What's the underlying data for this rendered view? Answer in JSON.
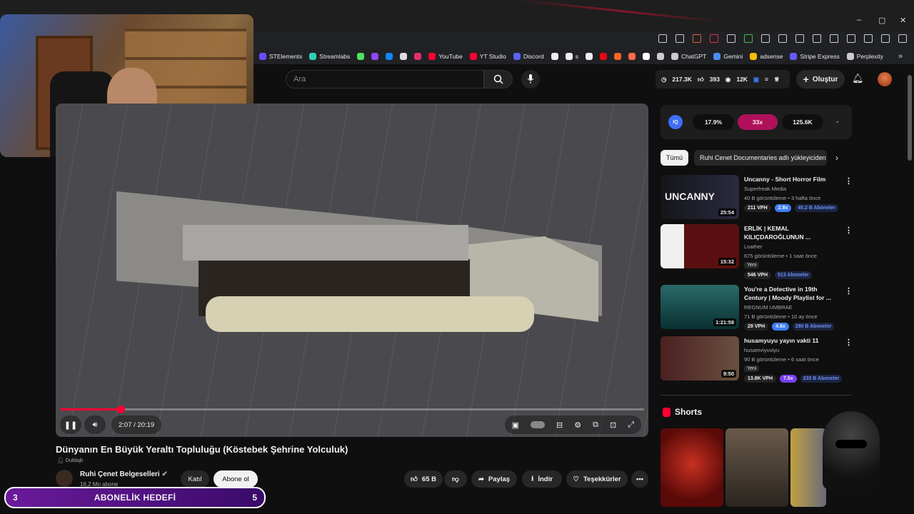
{
  "window": {
    "minimize": "–",
    "maximize": "▢",
    "close": "✕"
  },
  "bookmarks": [
    {
      "label": "STElements",
      "color": "#6a4cff"
    },
    {
      "label": "Streamlabs",
      "color": "#2fd0b0"
    },
    {
      "label": "",
      "color": "#52e060"
    },
    {
      "label": "",
      "color": "#9146ff"
    },
    {
      "label": "",
      "color": "#1185fe"
    },
    {
      "label": "",
      "color": "#dddddd"
    },
    {
      "label": "",
      "color": "#e1306c"
    },
    {
      "label": "YouTube",
      "color": "#ff0033"
    },
    {
      "label": "YT Studio",
      "color": "#ff0033"
    },
    {
      "label": "Discord",
      "color": "#5865f2"
    },
    {
      "label": "",
      "color": "#eeeeee"
    },
    {
      "label": "s",
      "color": "#eeeeee"
    },
    {
      "label": "",
      "color": "#eeeeee"
    },
    {
      "label": "",
      "color": "#e50914"
    },
    {
      "label": "",
      "color": "#f26522"
    },
    {
      "label": "",
      "color": "#ff6b4a"
    },
    {
      "label": "",
      "color": "#ffffff"
    },
    {
      "label": "",
      "color": "#cccccc"
    },
    {
      "label": "ChatGPT",
      "color": "#cccccc"
    },
    {
      "label": "Gemini",
      "color": "#4b8df8"
    },
    {
      "label": "adsense",
      "color": "#fbbc04"
    },
    {
      "label": "Stripe Express",
      "color": "#635bff"
    },
    {
      "label": "Perplexity",
      "color": "#cccccc"
    }
  ],
  "bookmarks_more": "»",
  "search": {
    "placeholder": "Ara"
  },
  "stats": {
    "views": "217.3K",
    "likes": "393",
    "watching": "12K"
  },
  "create_label": "Oluştur",
  "player": {
    "progress": 0.104,
    "time": "2:07 / 20:19"
  },
  "video": {
    "title": "Dünyanın En Büyük Yeraltı Topluluğu (Köstebek Şehrine Yolculuk)",
    "dubbed": "Dublajlı",
    "channel": "Ruhi Çenet Belgeselleri",
    "subs": "16,2 Mn abone",
    "join": "Katıl",
    "subscribe": "Abone ol",
    "likes": "65 B",
    "share": "Paylaş",
    "download": "İndir",
    "thanks": "Teşekkürler"
  },
  "goal": {
    "left": "3",
    "label": "ABONELİK HEDEFİ",
    "right": "5"
  },
  "iq": {
    "logo": "IQ",
    "m1": "17.9%",
    "m2": "33x",
    "m3": "125.6K"
  },
  "chips": {
    "all": "Tümü",
    "second": "Ruhi Cenet Documentaries adlı yükleyiciden"
  },
  "recs": [
    {
      "title": "Uncanny - Short Horror Film",
      "channel": "Superfreak Media",
      "meta": "40 B görüntüleme • 3 hafta önce",
      "duration": "25:54",
      "thumb_text": "UNCANNY",
      "vph": "211 VPH",
      "mult": "2.9x",
      "subs": "45.2 B Aboneler",
      "mult_color": "#3d7ff5",
      "new": ""
    },
    {
      "title": "ERLİK | KEMAL KILIÇDAROĞLUNUN ...",
      "channel": "Loather",
      "meta": "675 görüntüleme • 1 saat önce",
      "duration": "15:32",
      "thumb_text": "",
      "vph": "546 VPH",
      "mult": "",
      "subs": "513 Aboneler",
      "mult_color": "",
      "new": "Yeni"
    },
    {
      "title": "You're a Detective in 19th Century | Moody Playlist for ...",
      "channel": "REGNUM UMBRAE",
      "meta": "71 B görüntüleme • 10 ay önce",
      "duration": "1:21:58",
      "thumb_text": "",
      "vph": "29 VPH",
      "mult": "4.8x",
      "subs": "290 B Aboneler",
      "mult_color": "#3d7ff5",
      "new": ""
    },
    {
      "title": "husamyuyu yayın vakti 11",
      "channel": "husamviyuviyu",
      "meta": "90 B görüntüleme • 6 saat önce",
      "duration": "9:50",
      "thumb_text": "",
      "vph": "13.8K VPH",
      "mult": "7.5x",
      "subs": "235 B Aboneler",
      "mult_color": "#7a3df5",
      "new": "Yeni"
    }
  ],
  "shorts_label": "Shorts"
}
